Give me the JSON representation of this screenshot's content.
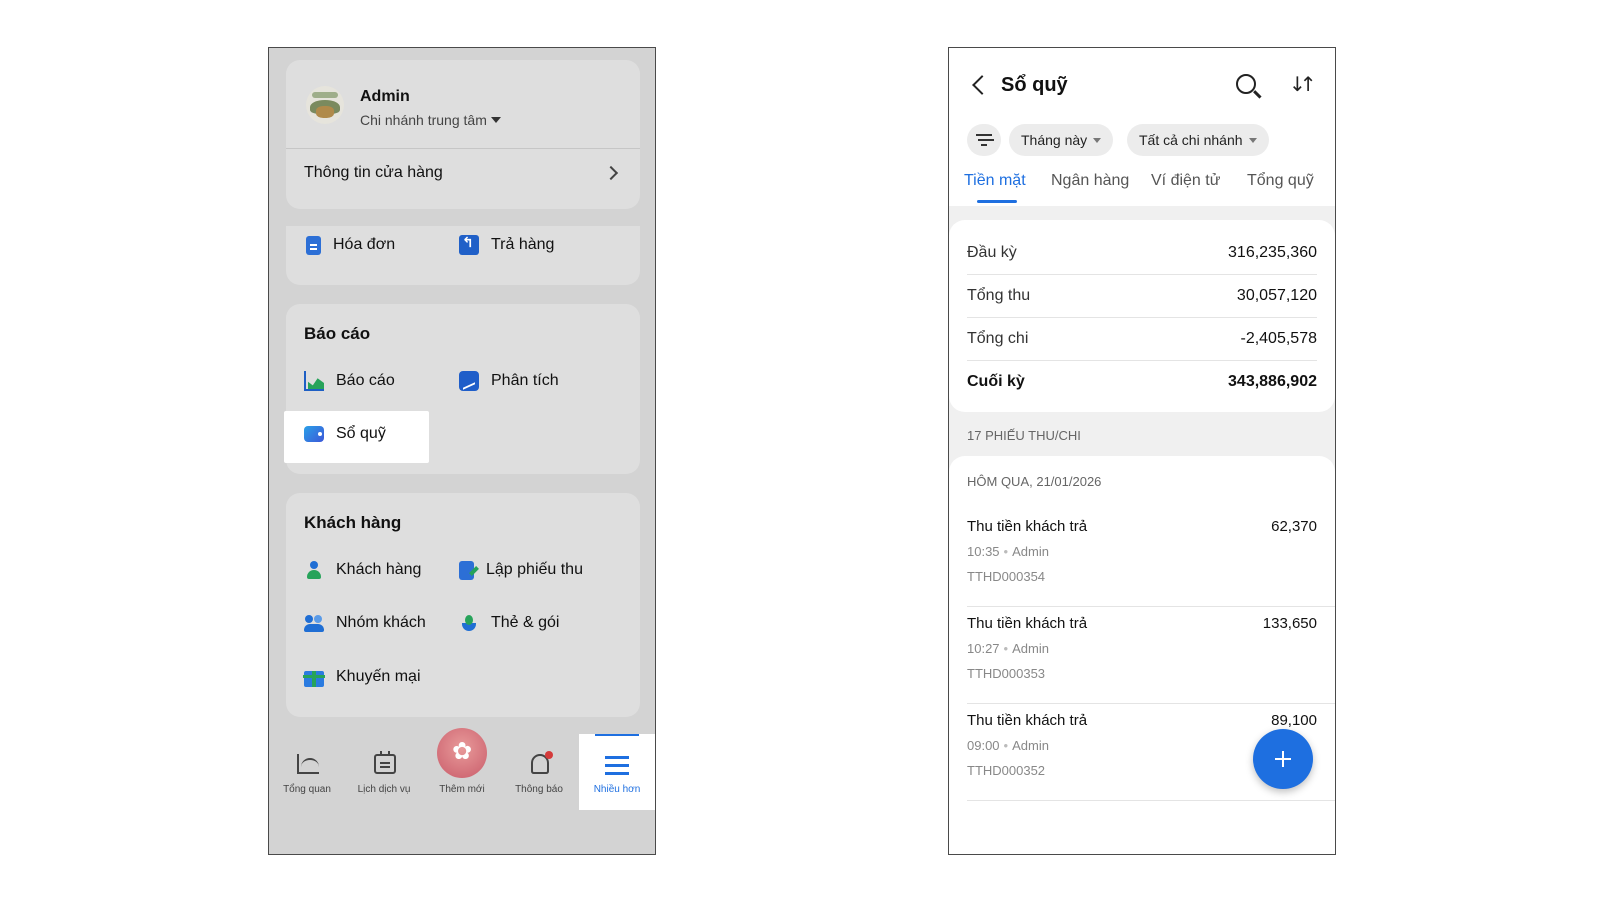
{
  "left": {
    "profile": {
      "name": "Admin",
      "branch": "Chi nhánh trung tâm",
      "store_info": "Thông tin cửa hàng"
    },
    "orders": [
      {
        "label": "Hóa đơn",
        "icon": "invoice-icon"
      },
      {
        "label": "Trả hàng",
        "icon": "return-icon"
      }
    ],
    "reports": {
      "title": "Báo cáo",
      "items": [
        {
          "label": "Báo cáo",
          "icon": "report-chart-icon"
        },
        {
          "label": "Phân tích",
          "icon": "analysis-icon"
        },
        {
          "label": "Sổ quỹ",
          "icon": "wallet-icon"
        }
      ]
    },
    "customers": {
      "title": "Khách hàng",
      "items": [
        {
          "label": "Khách hàng",
          "icon": "customer-icon"
        },
        {
          "label": "Lập phiếu thu",
          "icon": "receipt-form-icon"
        },
        {
          "label": "Nhóm khách",
          "icon": "customer-group-icon"
        },
        {
          "label": "Thẻ & gói",
          "icon": "card-package-icon"
        },
        {
          "label": "Khuyến mại",
          "icon": "gift-icon"
        }
      ]
    },
    "nav": [
      {
        "label": "Tổng quan"
      },
      {
        "label": "Lịch dịch vụ"
      },
      {
        "label": "Thêm mới"
      },
      {
        "label": "Thông báo"
      },
      {
        "label": "Nhiều hơn"
      }
    ]
  },
  "right": {
    "title": "Sổ quỹ",
    "filters": {
      "period": "Tháng này",
      "branch": "Tất cả chi nhánh"
    },
    "tabs": [
      "Tiền mặt",
      "Ngân hàng",
      "Ví điện tử",
      "Tổng quỹ"
    ],
    "active_tab": "Tiền mặt",
    "summary": [
      {
        "label": "Đầu kỳ",
        "value": "316,235,360"
      },
      {
        "label": "Tổng thu",
        "value": "30,057,120"
      },
      {
        "label": "Tổng chi",
        "value": "-2,405,578"
      },
      {
        "label": "Cuối kỳ",
        "value": "343,886,902"
      }
    ],
    "count_label": "17 PHIẾU THU/CHI",
    "date_header": "HÔM QUA, 21/01/2026",
    "transactions": [
      {
        "title": "Thu tiền khách trả",
        "amount": "62,370",
        "time": "10:35",
        "user": "Admin",
        "code": "TTHD000354"
      },
      {
        "title": "Thu tiền khách trả",
        "amount": "133,650",
        "time": "10:27",
        "user": "Admin",
        "code": "TTHD000353"
      },
      {
        "title": "Thu tiền khách trả",
        "amount": "89,100",
        "time": "09:00",
        "user": "Admin",
        "code": "TTHD000352"
      }
    ],
    "colors": {
      "accent": "#1e6fe0"
    }
  }
}
